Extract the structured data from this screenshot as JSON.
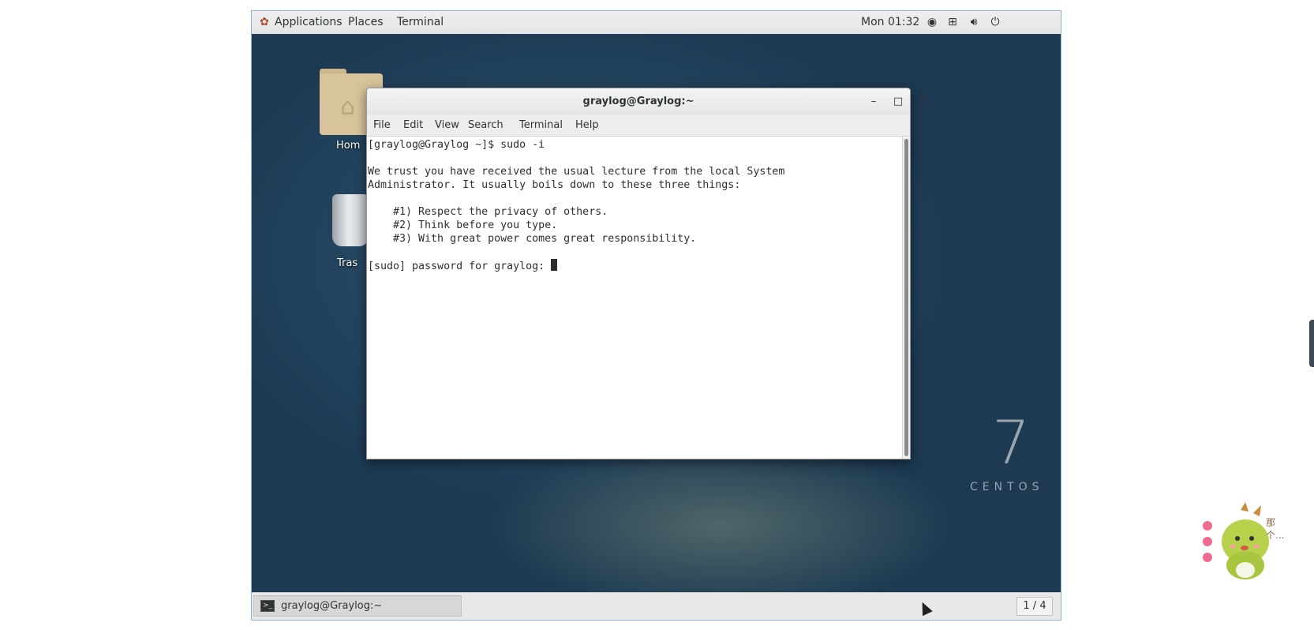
{
  "topbar": {
    "applications": "Applications",
    "places": "Places",
    "terminal": "Terminal",
    "clock": "Mon 01:32",
    "icons": [
      "accessibility-icon",
      "network-icon",
      "volume-icon",
      "power-icon"
    ]
  },
  "desktop": {
    "home_label": "Hom",
    "trash_label": "Tras",
    "watermark_number": "7",
    "watermark_text": "CENTOS"
  },
  "window": {
    "title": "graylog@Graylog:~",
    "menu": [
      "File",
      "Edit",
      "View",
      "Search",
      "Terminal",
      "Help"
    ],
    "lines": [
      "[graylog@Graylog ~]$ sudo -i",
      "",
      "We trust you have received the usual lecture from the local System",
      "Administrator. It usually boils down to these three things:",
      "",
      "    #1) Respect the privacy of others.",
      "    #2) Think before you type.",
      "    #3) With great power comes great responsibility.",
      "",
      "[sudo] password for graylog: "
    ]
  },
  "taskbar": {
    "task_label": "graylog@Graylog:~",
    "workspace": "1 / 4"
  },
  "mascot": {
    "caption": "那个..."
  }
}
